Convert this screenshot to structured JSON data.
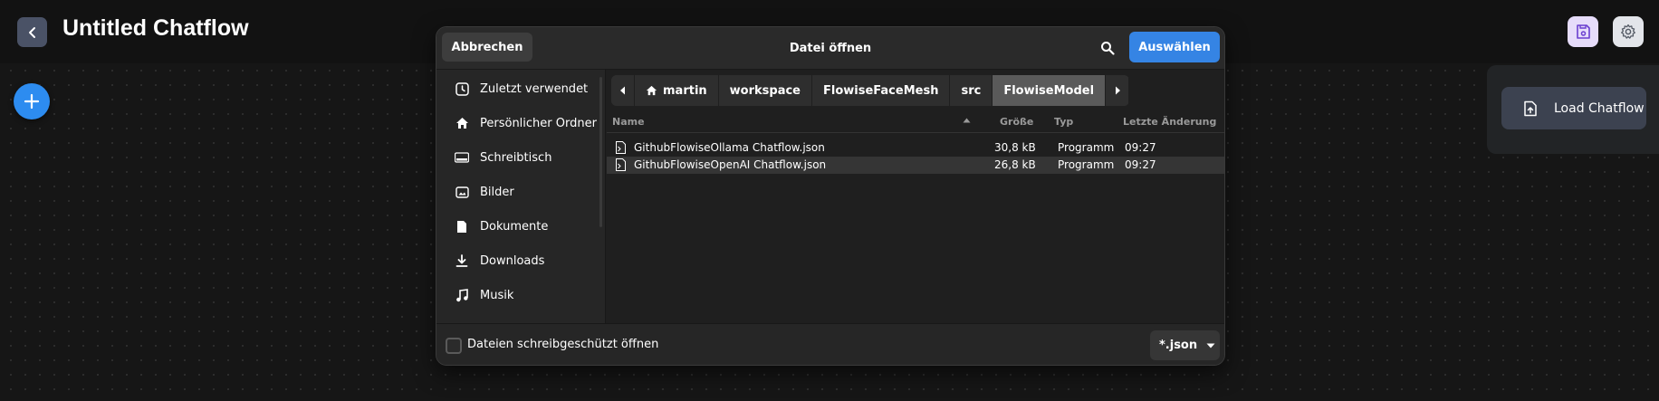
{
  "app": {
    "title": "Untitled Chatflow",
    "back_icon": "chevron-left-icon",
    "save_icon": "save-icon",
    "settings_icon": "gear-icon",
    "add_icon": "plus-icon"
  },
  "popover": {
    "load_label": "Load Chatflow",
    "load_icon": "file-upload-icon"
  },
  "dialog": {
    "title": "Datei öffnen",
    "cancel_label": "Abbrechen",
    "select_label": "Auswählen",
    "search_icon": "search-icon",
    "sidebar": [
      {
        "label": "Zuletzt verwendet",
        "icon": "recent-clock-icon"
      },
      {
        "label": "Persönlicher Ordner",
        "icon": "home-icon"
      },
      {
        "label": "Schreibtisch",
        "icon": "desktop-icon"
      },
      {
        "label": "Bilder",
        "icon": "image-icon"
      },
      {
        "label": "Dokumente",
        "icon": "document-icon"
      },
      {
        "label": "Downloads",
        "icon": "download-icon"
      },
      {
        "label": "Musik",
        "icon": "music-icon"
      }
    ],
    "path": [
      "martin",
      "workspace",
      "FlowiseFaceMesh",
      "src",
      "FlowiseModel"
    ],
    "columns": {
      "name": "Name",
      "size": "Größe",
      "type": "Typ",
      "modified": "Letzte Änderung"
    },
    "files": [
      {
        "name": "GithubFlowiseOllama Chatflow.json",
        "size": "30,8 kB",
        "type": "Programm",
        "modified": "09:27",
        "selected": false
      },
      {
        "name": "GithubFlowiseOpenAI Chatflow.json",
        "size": "26,8 kB",
        "type": "Programm",
        "modified": "09:27",
        "selected": true
      }
    ],
    "readonly_label": "Dateien schreibgeschützt öffnen",
    "filter_label": "*.json"
  },
  "colors": {
    "accent": "#3584e4",
    "add_button": "#2d8cf0",
    "save_button_bg": "#e6dcfa"
  }
}
